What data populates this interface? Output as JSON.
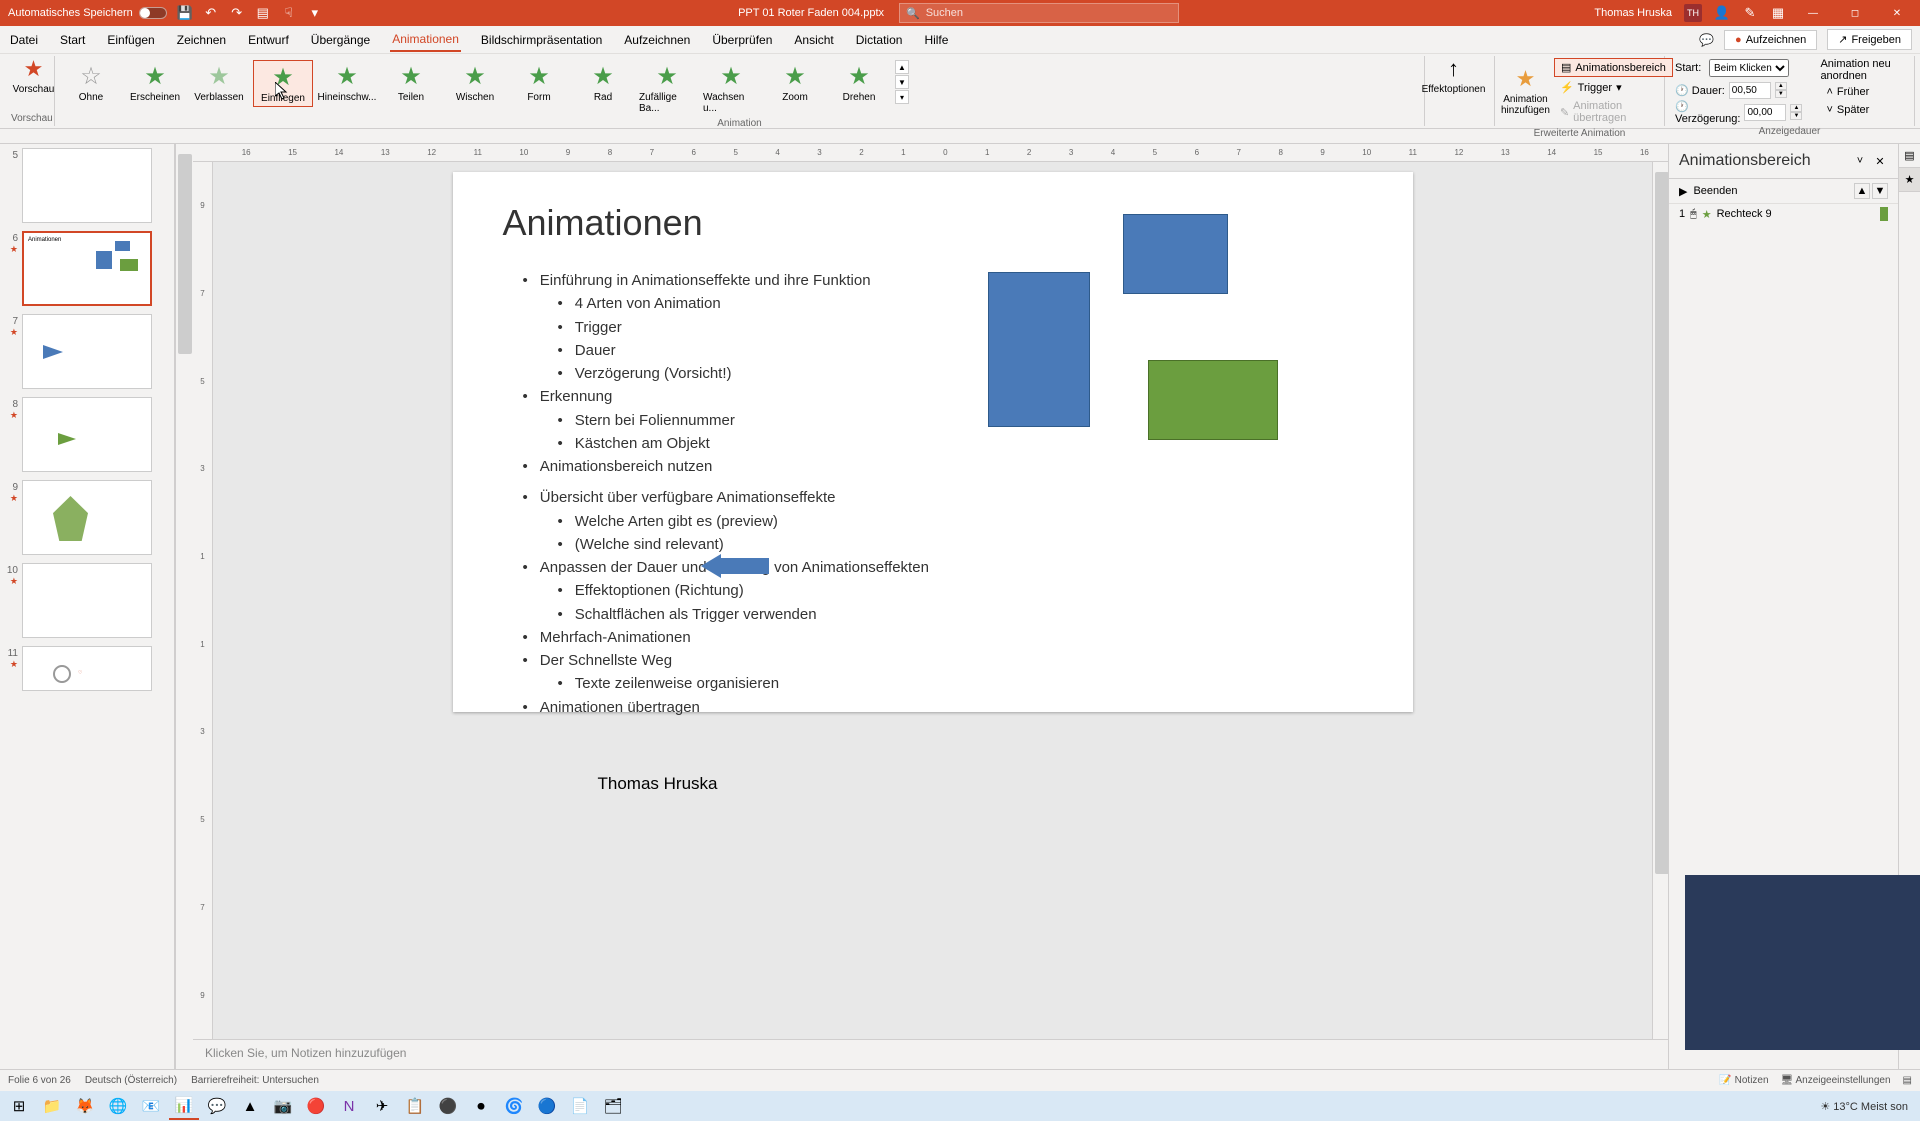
{
  "titlebar": {
    "autosave": "Automatisches Speichern",
    "filename": "PPT 01 Roter Faden 004.pptx",
    "search_placeholder": "Suchen",
    "username": "Thomas Hruska",
    "user_initials": "TH"
  },
  "menu": {
    "datei": "Datei",
    "start": "Start",
    "einfugen": "Einfügen",
    "zeichnen": "Zeichnen",
    "entwurf": "Entwurf",
    "ubergange": "Übergänge",
    "animationen": "Animationen",
    "bildschirm": "Bildschirmpräsentation",
    "aufzeichnen": "Aufzeichnen",
    "uberprufen": "Überprüfen",
    "ansicht": "Ansicht",
    "dictation": "Dictation",
    "hilfe": "Hilfe",
    "record": "Aufzeichnen",
    "share": "Freigeben"
  },
  "ribbon": {
    "vorschau": "Vorschau",
    "vorschau2": "Vorschau",
    "anims": {
      "ohne": "Ohne",
      "erscheinen": "Erscheinen",
      "verblassen": "Verblassen",
      "einfliegen": "Einfliegen",
      "hinein": "Hineinschw...",
      "teilen": "Teilen",
      "wischen": "Wischen",
      "form": "Form",
      "rad": "Rad",
      "zufallig": "Zufällige Ba...",
      "wachsen": "Wachsen u...",
      "zoom": "Zoom",
      "drehen": "Drehen"
    },
    "group_anim": "Animation",
    "effektoptionen": "Effektoptionen",
    "anim_add": "Animation hinzufügen",
    "erweiterte": "Erweiterte Animation",
    "anim_pane": "Animationsbereich",
    "trigger": "Trigger",
    "anim_copy": "Animation übertragen",
    "start_label": "Start:",
    "start_value": "Beim Klicken",
    "dauer": "Dauer:",
    "dauer_value": "00,50",
    "verzog": "Verzögerung:",
    "verzog_value": "00,00",
    "reorder": "Animation neu anordnen",
    "fruher": "Früher",
    "spater": "Später",
    "anzeigedauer": "Anzeigedauer"
  },
  "ruler_marks": [
    "16",
    "15",
    "14",
    "13",
    "12",
    "11",
    "10",
    "9",
    "8",
    "7",
    "6",
    "5",
    "4",
    "3",
    "2",
    "1",
    "0",
    "1",
    "2",
    "3",
    "4",
    "5",
    "6",
    "7",
    "8",
    "9",
    "10",
    "11",
    "12",
    "13",
    "14",
    "15",
    "16"
  ],
  "slide": {
    "title": "Animationen",
    "b1": "Einführung in Animationseffekte und ihre Funktion",
    "b1a": "4 Arten von Animation",
    "b1b": "Trigger",
    "b1c": "Dauer",
    "b1d": "Verzögerung (Vorsicht!)",
    "b2": "Erkennung",
    "b2a": "Stern bei Foliennummer",
    "b2b": "Kästchen am Objekt",
    "b3": "Animationsbereich nutzen",
    "b4": "Übersicht über verfügbare Animationseffekte",
    "b4a": "Welche Arten gibt es (preview)",
    "b4b": "(Welche sind relevant)",
    "b5": "Anpassen der Dauer und Richtung von Animationseffekten",
    "b5a": "Effektoptionen (Richtung)",
    "b5b": "Schaltflächen als Trigger verwenden",
    "b6": "Mehrfach-Animationen",
    "b7": "Der Schnellste Weg",
    "b7a": "Texte zeilenweise organisieren",
    "b8": "Animationen übertragen",
    "author": "Thomas Hruska"
  },
  "thumbs": {
    "n5": "5",
    "n6": "6",
    "n7": "7",
    "n8": "8",
    "n9": "9",
    "n10": "10",
    "n11": "11"
  },
  "pane": {
    "title": "Animationsbereich",
    "beenden": "Beenden",
    "item_num": "1",
    "item_name": "Rechteck 9"
  },
  "notes": "Klicken Sie, um Notizen hinzuzufügen",
  "status": {
    "slide": "Folie 6 von 26",
    "lang": "Deutsch (Österreich)",
    "access": "Barrierefreiheit: Untersuchen",
    "notizen": "Notizen",
    "anzeige": "Anzeigeeinstellungen"
  },
  "taskbar": {
    "weather": "13°C  Meist son"
  }
}
